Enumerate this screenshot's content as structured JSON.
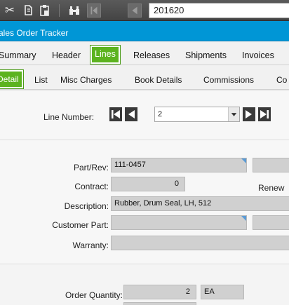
{
  "toolbar": {
    "order_number": "201620"
  },
  "window": {
    "title": "ales Order Tracker"
  },
  "main_tabs": [
    {
      "label": "Summary",
      "active": false
    },
    {
      "label": "Header",
      "active": false
    },
    {
      "label": "Lines",
      "active": true
    },
    {
      "label": "Releases",
      "active": false
    },
    {
      "label": "Shipments",
      "active": false
    },
    {
      "label": "Invoices",
      "active": false
    }
  ],
  "sub_tabs": [
    {
      "label": "Detail",
      "active": true
    },
    {
      "label": "List",
      "active": false
    },
    {
      "label": "Misc Charges",
      "active": false
    },
    {
      "label": "Book Details",
      "active": false
    },
    {
      "label": "Commissions",
      "active": false
    },
    {
      "label": "Co",
      "active": false
    }
  ],
  "line_nav": {
    "label": "Line Number:",
    "value": "2"
  },
  "part": {
    "part_rev_label": "Part/Rev:",
    "part_rev_value": "111-0457",
    "contract_label": "Contract:",
    "contract_value": "0",
    "renew_label": "Renew",
    "description_label": "Description:",
    "description_value": "Rubber, Drum Seal, LH, 512",
    "customer_part_label": "Customer Part:",
    "customer_part_value": "",
    "warranty_label": "Warranty:",
    "warranty_value": ""
  },
  "quantity": {
    "order_quantity_label": "Order Quantity:",
    "order_quantity_value": "2",
    "uom_value": "EA"
  },
  "colors": {
    "toolbar": "#4a4a4a",
    "title_bar": "#0096d6",
    "active_tab": "#5cb31f",
    "field_bg": "#d0d0d0"
  },
  "icons": [
    "cut-icon",
    "copy-icon",
    "paste-icon",
    "binoculars-icon",
    "first-record-icon",
    "previous-record-icon",
    "dropdown-arrow-icon",
    "next-record-icon",
    "last-record-icon"
  ]
}
